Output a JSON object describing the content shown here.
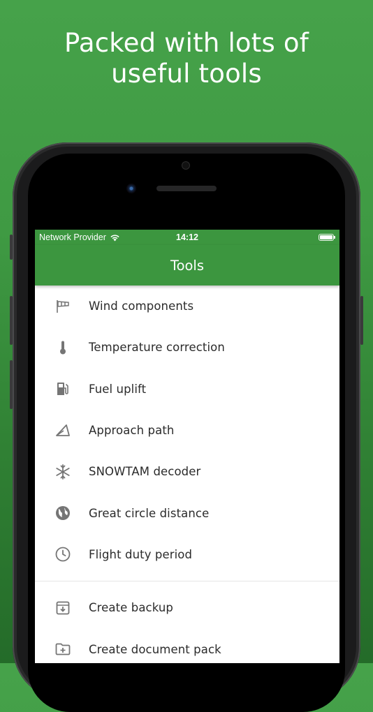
{
  "headline": {
    "line1": "Packed with lots of",
    "line2": "useful tools"
  },
  "status_bar": {
    "carrier": "Network Provider",
    "time": "14:12"
  },
  "app_bar": {
    "title": "Tools"
  },
  "tools": [
    {
      "label": "Wind components",
      "icon": "windsock-icon"
    },
    {
      "label": "Temperature correction",
      "icon": "thermometer-icon"
    },
    {
      "label": "Fuel uplift",
      "icon": "fuel-pump-icon"
    },
    {
      "label": "Approach path",
      "icon": "approach-path-icon"
    },
    {
      "label": "SNOWTAM decoder",
      "icon": "snowflake-icon"
    },
    {
      "label": "Great circle distance",
      "icon": "globe-icon"
    },
    {
      "label": "Flight duty period",
      "icon": "clock-icon"
    }
  ],
  "data_tools": [
    {
      "label": "Create backup",
      "icon": "archive-download-icon"
    },
    {
      "label": "Create document pack",
      "icon": "folder-add-icon"
    }
  ],
  "colors": {
    "primary": "#3c963f",
    "icon": "#757575",
    "text": "#2b2b2b"
  }
}
